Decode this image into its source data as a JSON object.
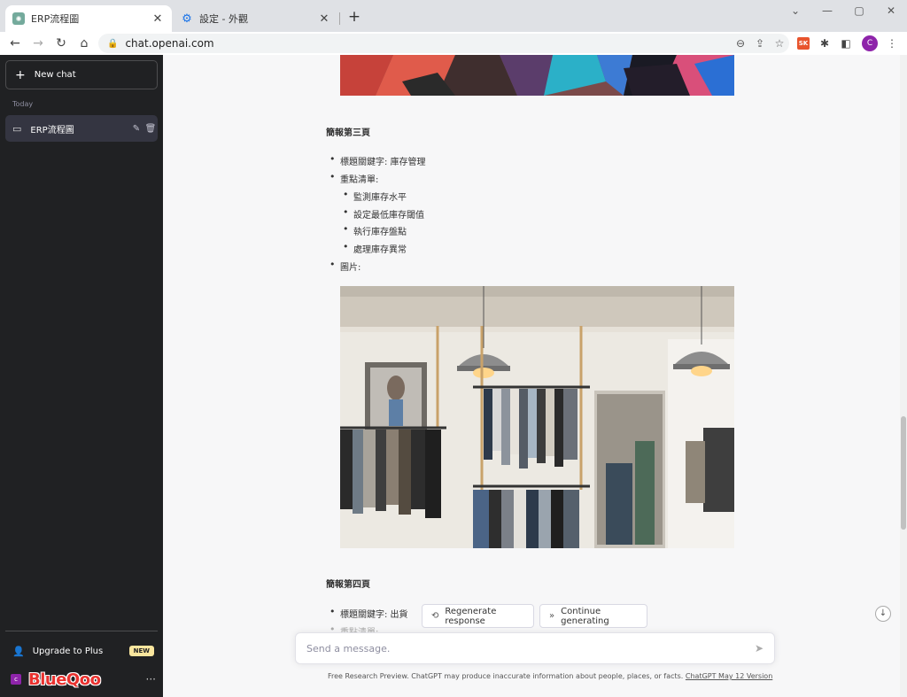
{
  "browser": {
    "tabs": [
      {
        "title": "ERP流程圖",
        "icon": "chatgpt-icon",
        "active": true
      },
      {
        "title": "設定 - 外觀",
        "icon": "gear-icon",
        "active": false
      }
    ],
    "new_tab": "+",
    "url": "chat.openai.com",
    "window_controls": {
      "chevron": "⌄",
      "minimize": "—",
      "maximize": "▢",
      "close": "✕"
    },
    "extension_sk": "SK",
    "profile_initial": "C"
  },
  "sidebar": {
    "new_chat": "New chat",
    "section": "Today",
    "chats": [
      {
        "title": "ERP流程圖"
      }
    ],
    "upgrade": "Upgrade to Plus",
    "new_badge": "NEW",
    "account_initial": "c",
    "account_name": "BlueQoo",
    "more": "···"
  },
  "content": {
    "page3": {
      "heading": "簡報第三頁",
      "keyword": "標題關鍵字: 庫存管理",
      "points_label": "重點清單:",
      "points": [
        "監測庫存水平",
        "設定最低庫存閾值",
        "執行庫存盤點",
        "處理庫存異常"
      ],
      "image_label": "圖片:"
    },
    "page4": {
      "heading": "簡報第四頁",
      "keyword": "標題關鍵字: 出貨",
      "points_label": "重點清單:"
    }
  },
  "actions": {
    "regenerate": "Regenerate response",
    "continue": "Continue generating"
  },
  "composer": {
    "placeholder": "Send a message."
  },
  "footer": {
    "disclaimer": "Free Research Preview. ChatGPT may produce inaccurate information about people, places, or facts.",
    "version_link": "ChatGPT May 12 Version"
  }
}
